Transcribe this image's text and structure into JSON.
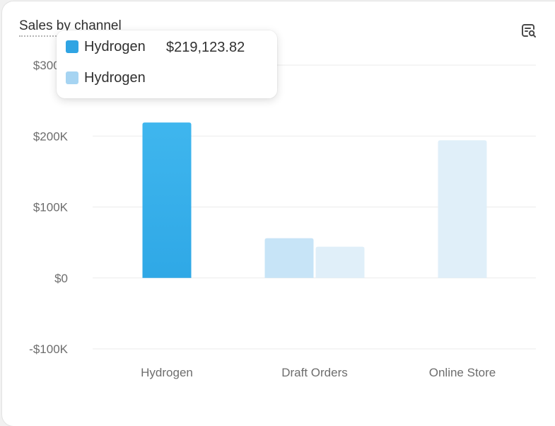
{
  "card": {
    "title": "Sales by channel",
    "explore_icon": "magnifier-chart-icon"
  },
  "colors": {
    "series_primary": "#2fa8e6",
    "series_primary_top": "#3fb6ee",
    "series_comparison": "#c7e4f7",
    "series_faded": "#e0eff9",
    "grid": "#ebebeb",
    "axis_text": "#6d6d6d",
    "tooltip_swatch_primary": "#2fa4e3",
    "tooltip_swatch_comparison": "#a6d4f2"
  },
  "tooltip": {
    "rows": [
      {
        "label": "Hydrogen",
        "value": "$219,123.82"
      },
      {
        "label": "Hydrogen",
        "value": ""
      }
    ]
  },
  "chart_data": {
    "type": "bar",
    "title": "Sales by channel",
    "categories": [
      "Hydrogen",
      "Draft Orders",
      "Online Store"
    ],
    "ylim": [
      -100000,
      300000
    ],
    "yticks": [
      300000,
      200000,
      100000,
      0,
      -100000
    ],
    "ytick_labels": [
      "$300K",
      "$200K",
      "$100K",
      "$0",
      "-$100K"
    ],
    "grid": true,
    "series": [
      {
        "values": [
          219123.82,
          56000,
          194000
        ]
      },
      {
        "values": [
          0,
          44000,
          0
        ]
      }
    ],
    "highlighted_category": "Hydrogen"
  }
}
